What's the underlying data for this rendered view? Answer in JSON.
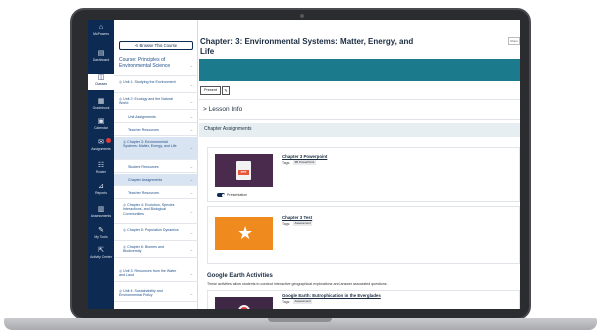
{
  "rail": [
    {
      "label": "McPowers",
      "glyph": "⌂"
    },
    {
      "label": "Dashboard",
      "glyph": "▤"
    },
    {
      "label": "Classes",
      "glyph": "◫"
    },
    {
      "label": "Gradebook",
      "glyph": "▦"
    },
    {
      "label": "Calendar",
      "glyph": "▣"
    },
    {
      "label": "Assignments",
      "glyph": "✉"
    },
    {
      "label": "Roster",
      "glyph": "☷"
    },
    {
      "label": "Reports",
      "glyph": "⊿"
    },
    {
      "label": "Assessments",
      "glyph": "▥"
    },
    {
      "label": "My Tools",
      "glyph": "✎"
    },
    {
      "label": "Activity Center",
      "glyph": "⇱"
    }
  ],
  "sidebar": {
    "browse_label": "⟲ Browse This Course",
    "course_title": "Course: Principles of Environmental Science",
    "items": [
      {
        "label": "◎ Unit 1: Studying the Environment"
      },
      {
        "label": "◎ Unit 2: Ecology and the Natural World"
      },
      {
        "label": "Unit Assignments"
      },
      {
        "label": "Teacher Resources"
      },
      {
        "label": "◎ Chapter 3: Environmental Systems: Matter, Energy, and Life"
      },
      {
        "label": "Student Resources"
      },
      {
        "label": "Chapter Assignments"
      },
      {
        "label": "Teacher Resources"
      },
      {
        "label": "◎ Chapter 4: Evolution, Species Interactions, and Biological Communities"
      },
      {
        "label": "◎ Chapter 5: Population Dynamics"
      },
      {
        "label": "◎ Chapter 6: Biomes and Biodiversity"
      },
      {
        "label": "◎ Unit 3: Resources from the Water and Land"
      },
      {
        "label": "◎ Unit 4: Sustainability and Environmental Policy"
      }
    ],
    "arrow": "→"
  },
  "main": {
    "title": "Chapter: 3: Environmental Systems: Matter, Energy, and Life",
    "top_button": "Share",
    "present_label": "Present",
    "edit_glyph": "✎",
    "lesson_info": "Lesson Info",
    "lesson_chevron": ">",
    "chapter_assignments": "Chapter Assignments",
    "cards": [
      {
        "title": "Chapter 3 Powerpoint",
        "tags_label": "Tags:",
        "tag": "3B PowerPoint",
        "thumb_text": "PPT"
      },
      {
        "title": "Chapter 3 Test",
        "tags_label": "Tags:",
        "tag": "Assessment",
        "thumb_text": "★"
      }
    ],
    "toggle_label": "Presentation",
    "ge_heading": "Google Earth Activities",
    "ge_desc": "These activities allow students to conduct interactive geographical explorations and answer associated questions.",
    "ge_card": {
      "title": "Google Earth: Eutrophication in the Everglades",
      "tags_label": "Tags:",
      "tag": "Assessment"
    }
  }
}
